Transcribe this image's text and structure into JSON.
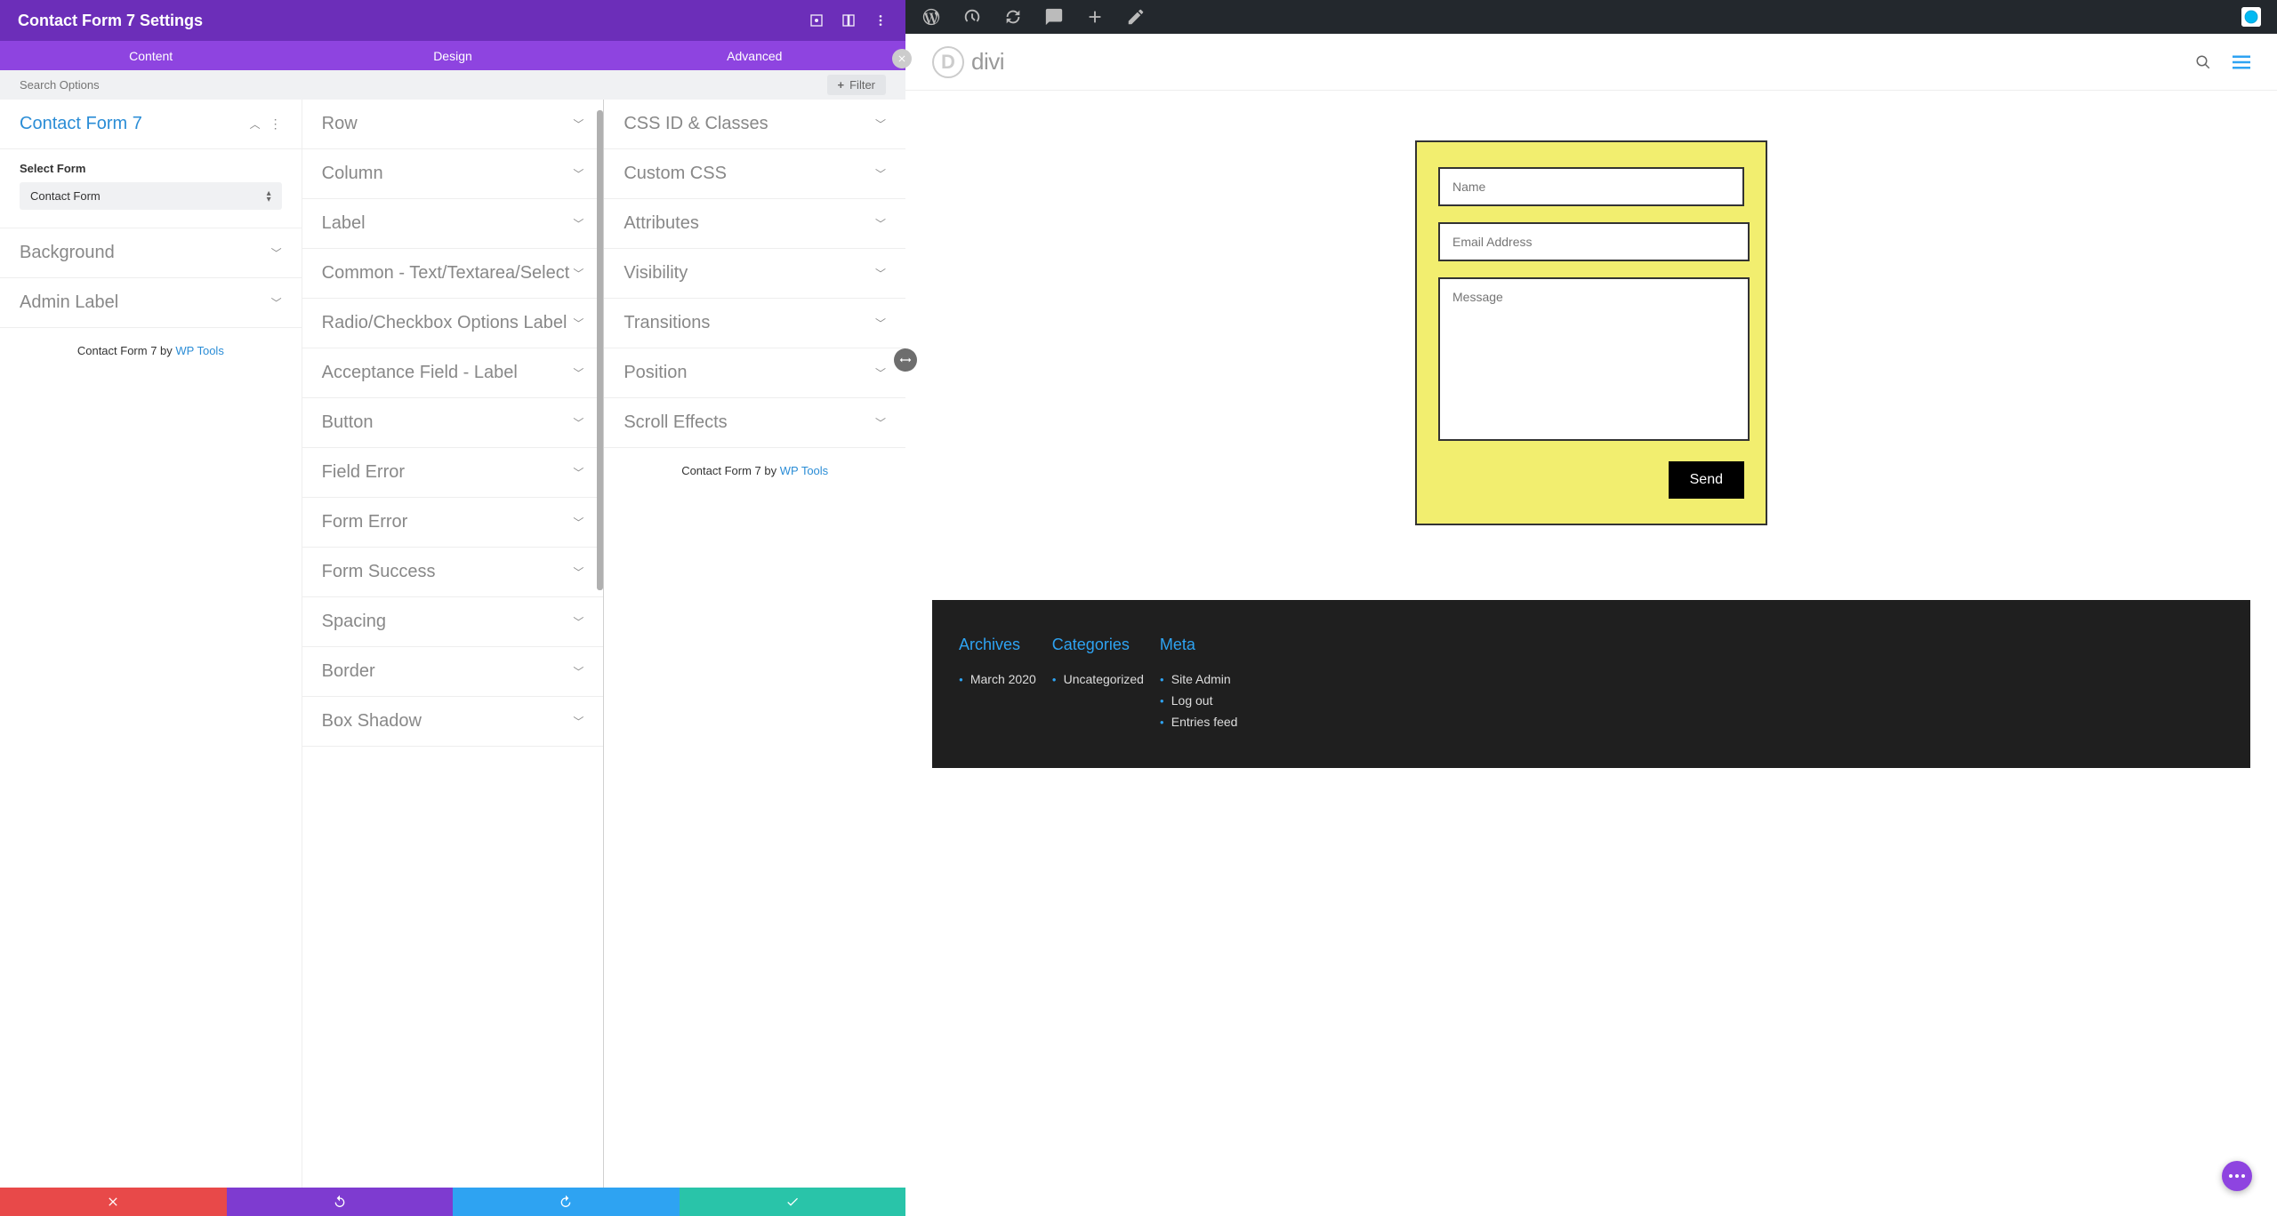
{
  "header": {
    "title": "Contact Form 7 Settings"
  },
  "tabs": {
    "content": "Content",
    "design": "Design",
    "advanced": "Advanced"
  },
  "search": {
    "placeholder": "Search Options",
    "filter_label": "Filter"
  },
  "col1": {
    "section_cf7": "Contact Form 7",
    "select_form_label": "Select Form",
    "select_form_value": "Contact Form",
    "section_bg": "Background",
    "section_admin": "Admin Label",
    "attribution_prefix": "Contact Form 7 by ",
    "attribution_link": "WP Tools"
  },
  "col2_items": [
    "Row",
    "Column",
    "Label",
    "Common - Text/Textarea/Select",
    "Radio/Checkbox Options Label",
    "Acceptance Field - Label",
    "Button",
    "Field Error",
    "Form Error",
    "Form Success",
    "Spacing",
    "Border",
    "Box Shadow"
  ],
  "col3_items": [
    "CSS ID & Classes",
    "Custom CSS",
    "Attributes",
    "Visibility",
    "Transitions",
    "Position",
    "Scroll Effects"
  ],
  "col3_attribution_prefix": "Contact Form 7 by ",
  "col3_attribution_link": "WP Tools",
  "preview": {
    "logo_text": "divi",
    "form": {
      "name_ph": "Name",
      "email_ph": "Email Address",
      "message_ph": "Message",
      "send_label": "Send"
    }
  },
  "footer": {
    "archives_title": "Archives",
    "archives_items": [
      "March 2020"
    ],
    "categories_title": "Categories",
    "categories_items": [
      "Uncategorized"
    ],
    "meta_title": "Meta",
    "meta_items": [
      "Site Admin",
      "Log out",
      "Entries feed"
    ]
  }
}
